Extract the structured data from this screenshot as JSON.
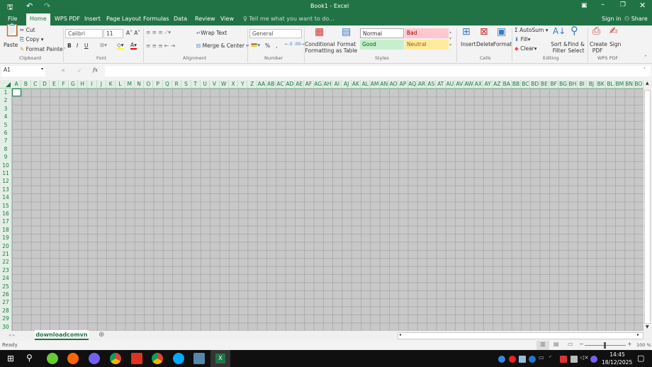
{
  "window": {
    "title": "Book1 - Excel",
    "signin": "Sign in",
    "share": "Share"
  },
  "tabs": [
    "File",
    "Home",
    "WPS PDF",
    "Insert",
    "Page Layout",
    "Formulas",
    "Data",
    "Review",
    "View"
  ],
  "tell_me": "Tell me what you want to do...",
  "clipboard": {
    "paste": "Paste",
    "cut": "Cut",
    "copy": "Copy",
    "format_painter": "Format Painter",
    "group": "Clipboard"
  },
  "font": {
    "name": "Calibri",
    "size": "11",
    "bold": "B",
    "italic": "I",
    "underline": "U",
    "group": "Font"
  },
  "alignment": {
    "wrap": "Wrap Text",
    "merge": "Merge & Center",
    "group": "Alignment"
  },
  "number": {
    "format": "General",
    "percent": "%",
    "comma": ",",
    "group": "Number"
  },
  "styles": {
    "conditional": "Conditional Formatting",
    "format_table": "Format as Table",
    "normal": "Normal",
    "bad": "Bad",
    "good": "Good",
    "neutral": "Neutral",
    "group": "Styles"
  },
  "cells": {
    "insert": "Insert",
    "delete": "Delete",
    "format": "Format",
    "group": "Cells"
  },
  "editing": {
    "autosum": "AutoSum",
    "fill": "Fill",
    "clear": "Clear",
    "sort": "Sort & Filter",
    "find": "Find & Select",
    "group": "Editing"
  },
  "wps": {
    "create": "Create PDF",
    "sign": "Sign",
    "group": "WPS PDF"
  },
  "formula_bar": {
    "name_box": "A1",
    "fx": "fx",
    "value": ""
  },
  "columns": [
    "A",
    "B",
    "C",
    "D",
    "E",
    "F",
    "G",
    "H",
    "I",
    "J",
    "K",
    "L",
    "M",
    "N",
    "O",
    "P",
    "Q",
    "R",
    "S",
    "T",
    "U",
    "V",
    "W",
    "X",
    "Y",
    "Z",
    "AA",
    "AB",
    "AC",
    "AD",
    "AE",
    "AF",
    "AG",
    "AH",
    "AI",
    "AJ",
    "AK",
    "AL",
    "AM",
    "AN",
    "AO",
    "AP",
    "AQ",
    "AR",
    "AS",
    "AT",
    "AU",
    "AV",
    "AW",
    "AX",
    "AY",
    "AZ",
    "BA",
    "BB",
    "BC",
    "BD",
    "BE",
    "BF",
    "BG",
    "BH",
    "BI",
    "BJ",
    "BK",
    "BL",
    "BM",
    "BN",
    "BO"
  ],
  "rows": 30,
  "sheet": {
    "name": "downloadcomvn"
  },
  "status": {
    "text": "Ready",
    "zoom": "100 %",
    "zoom_percent": 100
  },
  "clock": {
    "time": "14:45",
    "date": "18/12/2025"
  },
  "colors": {
    "accent": "#217346",
    "grid": "#c8c8c8"
  }
}
